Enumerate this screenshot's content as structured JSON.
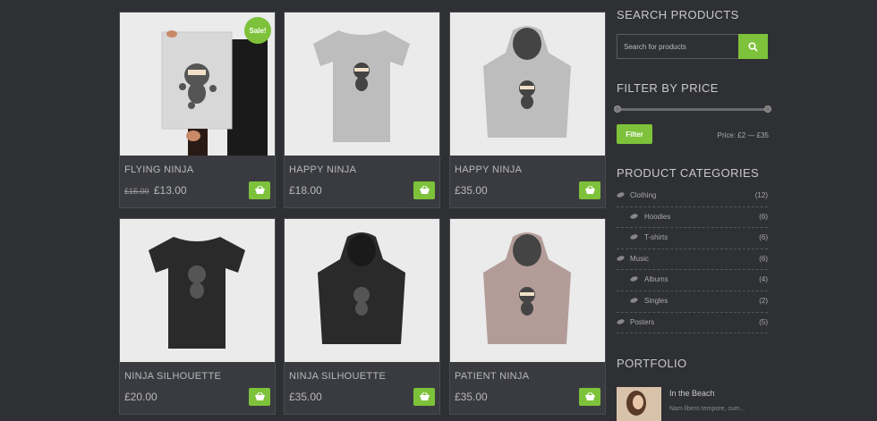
{
  "products": [
    {
      "title": "FLYING NINJA",
      "old_price": "£15.00",
      "price": "£13.00",
      "sale": "Sale!",
      "image": "poster-ninja"
    },
    {
      "title": "HAPPY NINJA",
      "price": "£18.00",
      "image": "grey-tshirt-ninja"
    },
    {
      "title": "HAPPY NINJA",
      "price": "£35.00",
      "image": "grey-hoodie-ninja"
    },
    {
      "title": "NINJA SILHOUETTE",
      "price": "£20.00",
      "image": "black-tshirt-ninja"
    },
    {
      "title": "NINJA SILHOUETTE",
      "price": "£35.00",
      "image": "black-hoodie-ninja"
    },
    {
      "title": "PATIENT NINJA",
      "price": "£35.00",
      "image": "pink-hoodie-ninja"
    }
  ],
  "sidebar": {
    "search_title": "SEARCH PRODUCTS",
    "search_placeholder": "Search for products",
    "filter_title": "FILTER BY PRICE",
    "filter_button": "Filter",
    "price_range": "Price: £2 — £35",
    "categories_title": "PRODUCT CATEGORIES",
    "categories": [
      {
        "name": "Clothing",
        "count": "(12)",
        "level": "top"
      },
      {
        "name": "Hoodies",
        "count": "(6)",
        "level": "sub"
      },
      {
        "name": "T-shirts",
        "count": "(6)",
        "level": "sub"
      },
      {
        "name": "Music",
        "count": "(6)",
        "level": "top"
      },
      {
        "name": "Albums",
        "count": "(4)",
        "level": "sub"
      },
      {
        "name": "Singles",
        "count": "(2)",
        "level": "sub"
      },
      {
        "name": "Posters",
        "count": "(5)",
        "level": "top"
      }
    ],
    "portfolio_title": "PORTFOLIO",
    "portfolio_item": {
      "title": "In the Beach",
      "excerpt": "Nam libero tempore, cum..."
    }
  },
  "colors": {
    "accent": "#7dc23a",
    "background": "#2f3034",
    "card": "#3a3b40"
  },
  "icons": {
    "cart": "basket-icon",
    "search": "search-icon",
    "category": "leaf-icon"
  }
}
